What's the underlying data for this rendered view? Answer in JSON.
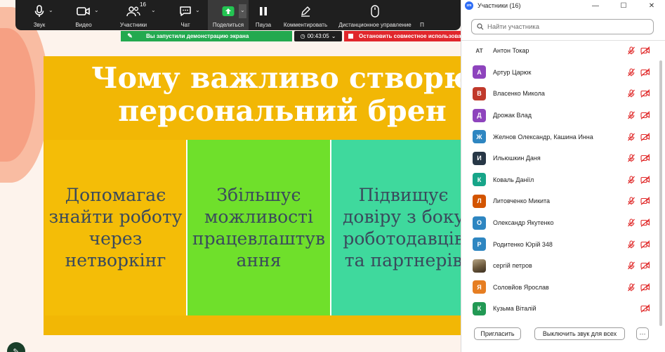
{
  "toolbar": {
    "items": [
      {
        "label": "Звук",
        "icon": "microphone-icon"
      },
      {
        "label": "Видео",
        "icon": "video-camera-icon"
      },
      {
        "label": "Участники",
        "icon": "participants-icon",
        "count": "16"
      },
      {
        "label": "Чат",
        "icon": "chat-icon"
      },
      {
        "label": "Поделиться",
        "icon": "share-screen-icon"
      },
      {
        "label": "Пауза",
        "icon": "pause-icon"
      },
      {
        "label": "Комментировать",
        "icon": "annotate-pencil-icon"
      },
      {
        "label": "Дистанционное управление",
        "icon": "remote-control-mouse-icon"
      }
    ]
  },
  "share_status": {
    "message": "Вы запустили демонстрацию экрана",
    "timer": "00:43:05",
    "stop_label": "Остановить совместное использование"
  },
  "slide": {
    "title": "Чому важливо створю\nперсональний брен",
    "cards": [
      "Допомагає\nзнайти роботу\nчерез\nнетворкінг",
      "Збільшує\nможливості\nпрацевлаштув\nання",
      "Підвищує\nдовіру з боку\nроботодавців\nта партнерів"
    ]
  },
  "panel": {
    "title": "Участники (16)",
    "search_placeholder": "Найти участника",
    "participants": [
      {
        "name": "Антон Токар",
        "initial": "АТ",
        "color": "",
        "style": "plain",
        "video_only": false
      },
      {
        "name": "Артур  Царюк",
        "initial": "А",
        "color": "#8e44bd",
        "style": "letter",
        "video_only": false
      },
      {
        "name": "Власенко Микола",
        "initial": "В",
        "color": "#c0392b",
        "style": "letter",
        "video_only": false
      },
      {
        "name": "Дрожак Влад",
        "initial": "Д",
        "color": "#8e44bd",
        "style": "letter",
        "video_only": false
      },
      {
        "name": "Желнов Олександр, Кашина Инна",
        "initial": "Ж",
        "color": "#2e86c1",
        "style": "letter",
        "video_only": false
      },
      {
        "name": "Ильюшкин Даня",
        "initial": "И",
        "color": "#273746",
        "style": "letter",
        "video_only": false
      },
      {
        "name": "Коваль Даніїл",
        "initial": "К",
        "color": "#17a589",
        "style": "letter",
        "video_only": false
      },
      {
        "name": "Литовченко Микита",
        "initial": "Л",
        "color": "#d35400",
        "style": "letter",
        "video_only": false
      },
      {
        "name": "Олександр Якутенко",
        "initial": "О",
        "color": "#2e86c1",
        "style": "letter",
        "video_only": false
      },
      {
        "name": "Родитенко Юрій 348",
        "initial": "Р",
        "color": "#2e86c1",
        "style": "letter",
        "video_only": false
      },
      {
        "name": "сергій петров",
        "initial": "",
        "color": "",
        "style": "photo",
        "video_only": false
      },
      {
        "name": "Соловйов Ярослав",
        "initial": "Я",
        "color": "#e67e22",
        "style": "letter",
        "video_only": false
      },
      {
        "name": "Кузьма Віталій",
        "initial": "К",
        "color": "#229954",
        "style": "letter",
        "video_only": true
      }
    ],
    "invite_label": "Пригласить",
    "mute_all_label": "Выключить звук для всех",
    "more_label": "···"
  },
  "colors": {
    "toolbar_bg": "#1f1f1f",
    "share_green": "#23a94f",
    "stop_red": "#e0262b",
    "muted_icon_red": "#e02828",
    "slide_yellow": "#f2b705",
    "card_green": "#6fe02b",
    "card_teal": "#3fd99d"
  }
}
